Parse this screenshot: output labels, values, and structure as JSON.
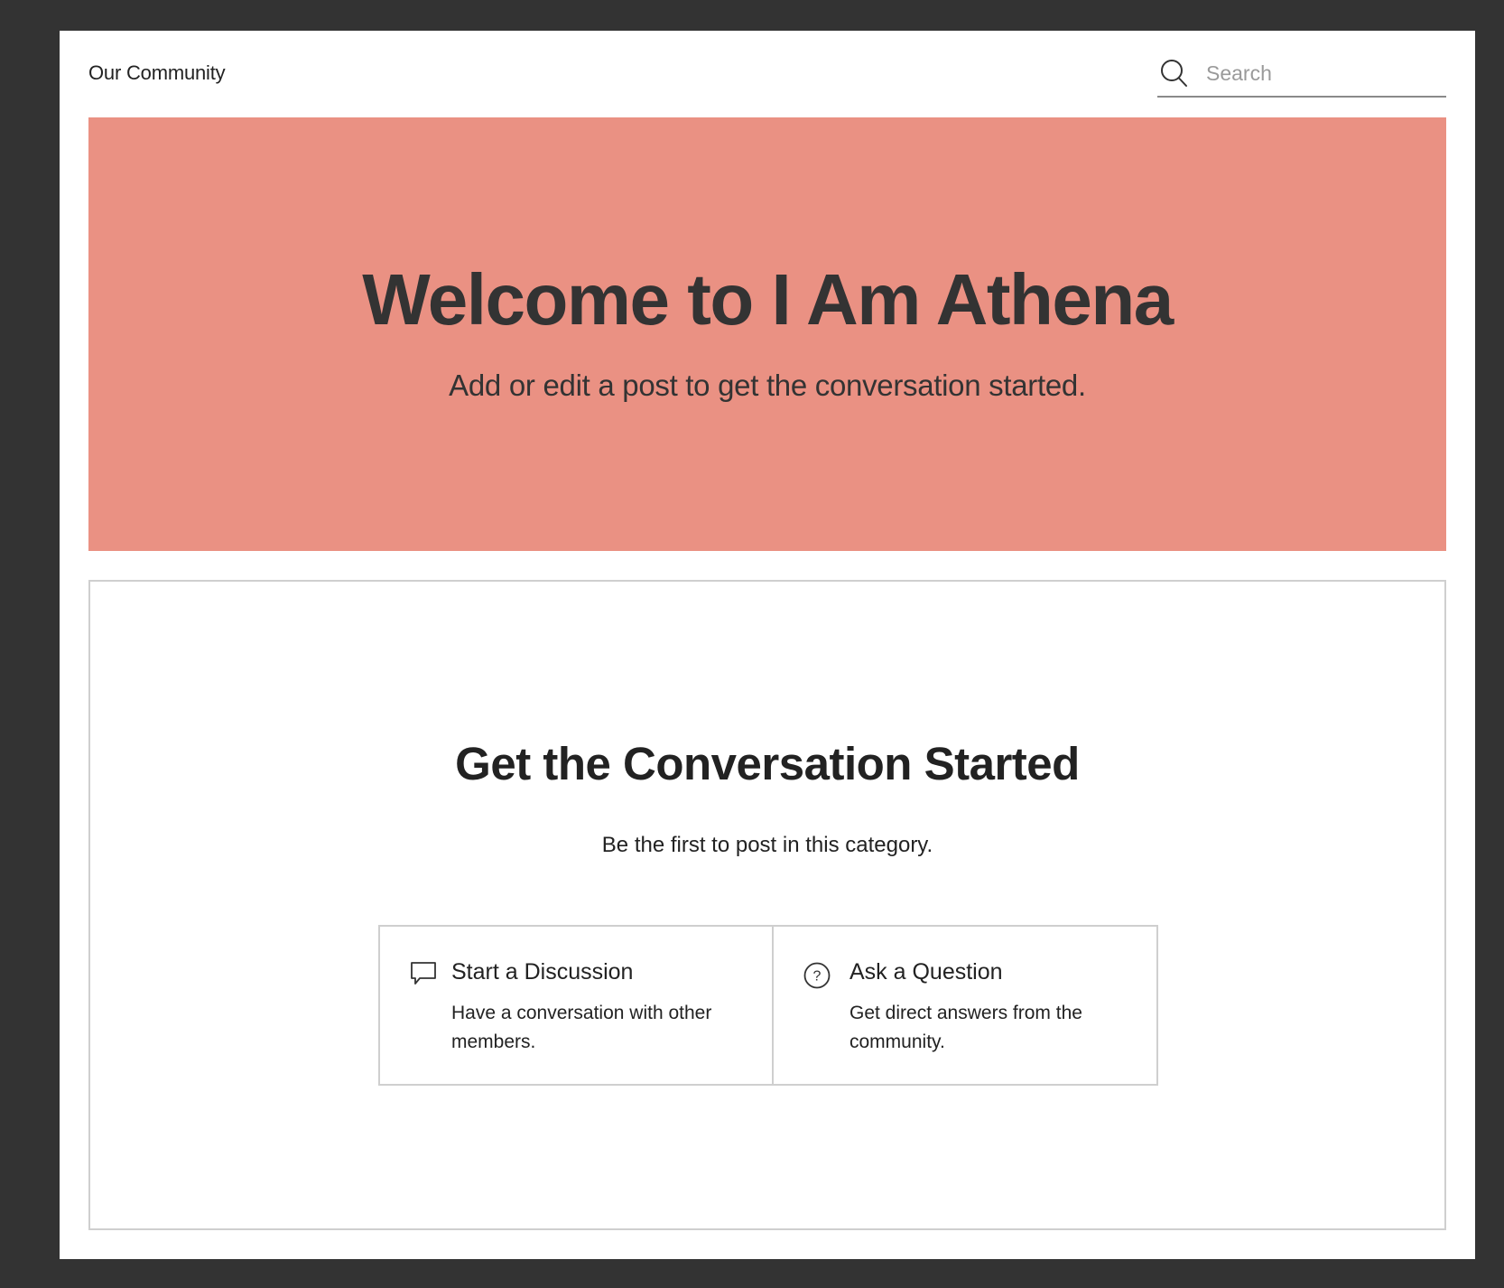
{
  "header": {
    "site_name": "Our Community",
    "search": {
      "placeholder": "Search",
      "value": "",
      "icon": "search-icon"
    }
  },
  "hero": {
    "title": "Welcome to I Am Athena",
    "subtitle": "Add or edit a post to get the conversation started.",
    "background_color": "#ea9183"
  },
  "empty_state": {
    "title": "Get the Conversation Started",
    "subtitle": "Be the first to post in this category.",
    "actions": [
      {
        "icon": "chat-bubble-icon",
        "label": "Start a Discussion",
        "description": "Have a conversation with other members."
      },
      {
        "icon": "question-circle-icon",
        "label": "Ask a Question",
        "description": "Get direct answers from the community."
      }
    ]
  }
}
